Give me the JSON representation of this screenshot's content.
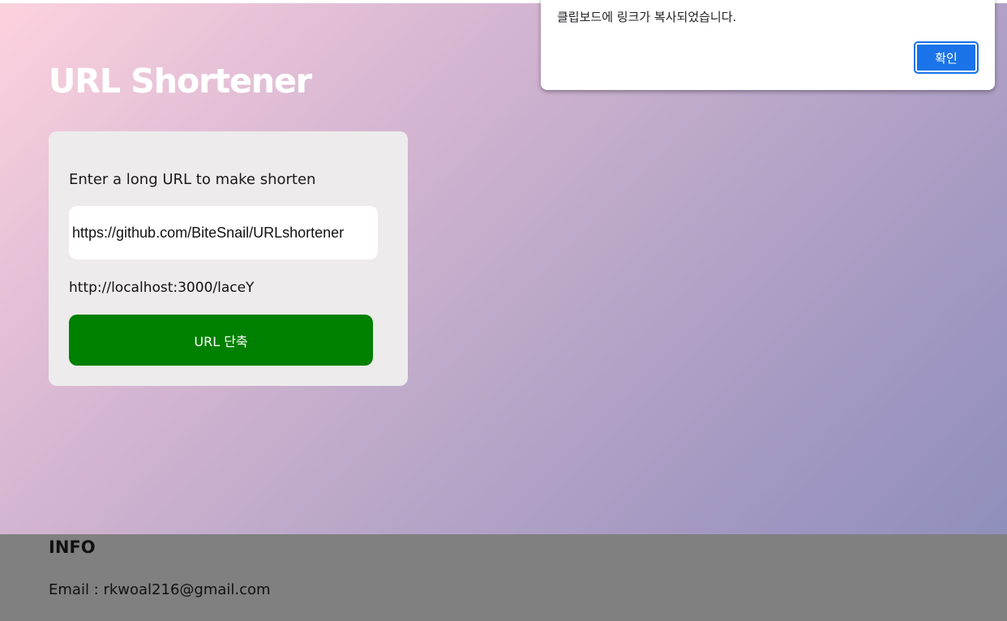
{
  "app": {
    "title": "URL Shortener"
  },
  "form": {
    "label": "Enter a long URL to make shorten",
    "input_value": "https://github.com/BiteSnail/URLshortener",
    "short_url": "http://localhost:3000/laceY",
    "submit_label": "URL 단축"
  },
  "footer": {
    "heading": "INFO",
    "email": "Email : rkwoal216@gmail.com"
  },
  "alert": {
    "message": "클립보드에 링크가 복사되었습니다.",
    "ok_label": "확인"
  },
  "colors": {
    "button_green": "#008000",
    "card_bg": "#edebec",
    "footer_bg": "#808080",
    "dialog_button_blue": "#1a73e8"
  }
}
